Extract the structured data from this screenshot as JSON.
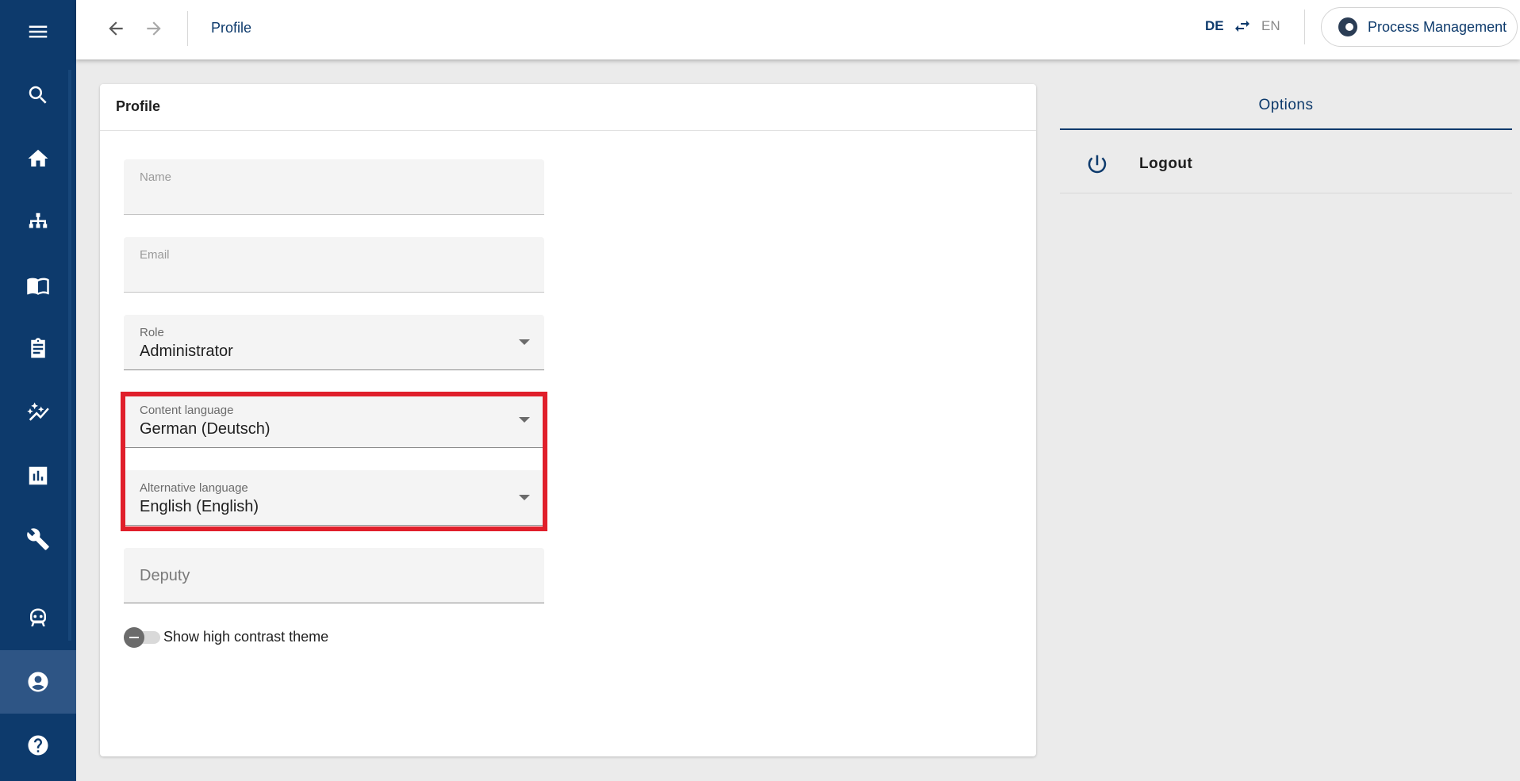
{
  "header": {
    "title": "Profile",
    "lang_primary": "DE",
    "lang_secondary": "EN",
    "app_button_label": "Process Management"
  },
  "sidebar": {
    "items": [
      {
        "icon": "menu-icon"
      },
      {
        "icon": "search-icon"
      },
      {
        "icon": "home-icon"
      },
      {
        "icon": "sitemap-icon"
      },
      {
        "icon": "book-icon"
      },
      {
        "icon": "clipboard-icon"
      },
      {
        "icon": "auto-graph-icon"
      },
      {
        "icon": "bar-chart-icon"
      },
      {
        "icon": "wrench-icon"
      },
      {
        "icon": "robot-icon"
      },
      {
        "icon": "account-circle-icon",
        "active": true
      },
      {
        "icon": "help-icon"
      }
    ]
  },
  "profile": {
    "title": "Profile",
    "name": {
      "label": "Name",
      "value": ""
    },
    "email": {
      "label": "Email",
      "value": ""
    },
    "role": {
      "label": "Role",
      "value": "Administrator"
    },
    "content_language": {
      "label": "Content language",
      "value": "German (Deutsch)"
    },
    "alternative_language": {
      "label": "Alternative language",
      "value": "English (English)"
    },
    "deputy": {
      "placeholder": "Deputy",
      "value": ""
    },
    "high_contrast": {
      "label": "Show high contrast theme",
      "checked": false
    }
  },
  "options": {
    "title": "Options",
    "logout_label": "Logout"
  },
  "colors": {
    "sidebar": "#0d3a6c",
    "accent": "#0d3a6c",
    "highlight": "#e01f2b",
    "background": "#ebebeb"
  }
}
